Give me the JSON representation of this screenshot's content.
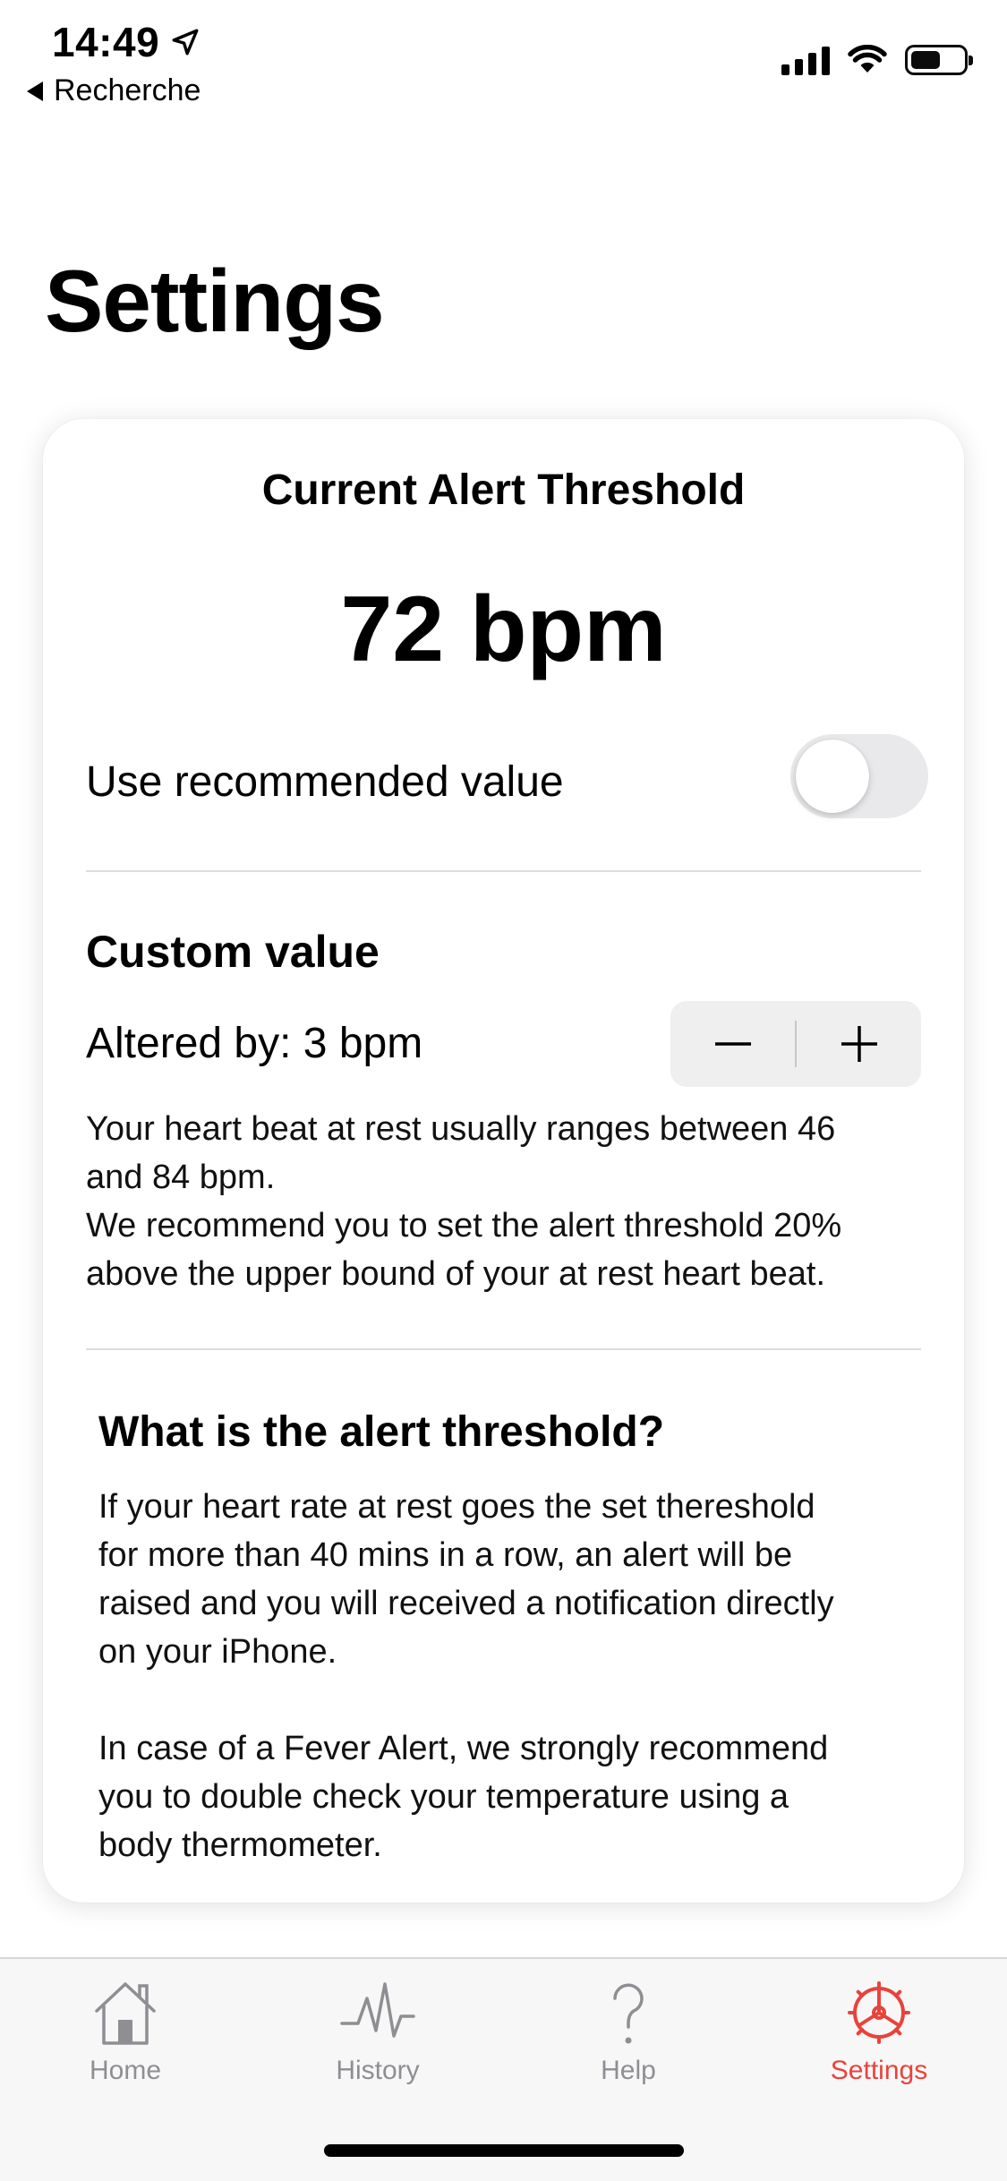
{
  "status_bar": {
    "time": "14:49",
    "back_label": "Recherche",
    "battery_level": 0.55
  },
  "page": {
    "title": "Settings"
  },
  "card": {
    "heading": "Current Alert Threshold",
    "threshold_value": "72 bpm",
    "use_recommended_label": "Use recommended value",
    "use_recommended_on": false,
    "custom_heading": "Custom value",
    "altered_label": "Altered by: 3 bpm",
    "stepper_minus": "−",
    "stepper_plus": "+",
    "range_text": "Your heart beat at rest usually ranges between 46\nand 84 bpm.\nWe recommend you to set the alert threshold 20%\nabove the upper bound of your at rest heart beat.",
    "info_heading": "What is the alert threshold?",
    "info_text_1": "If your heart rate at rest goes the set thereshold\nfor more than 40 mins in a row, an alert will be\nraised and you will received a notification directly\non your iPhone.",
    "info_text_2": "In case of a Fever Alert, we strongly recommend\nyou to double check your temperature using a\nbody thermometer."
  },
  "tab_bar": {
    "tabs": [
      {
        "label": "Home",
        "icon": "house-icon"
      },
      {
        "label": "History",
        "icon": "heartbeat-icon"
      },
      {
        "label": "Help",
        "icon": "question-mark-icon"
      },
      {
        "label": "Settings",
        "icon": "gear-icon"
      }
    ],
    "active": "Settings",
    "active_color": "#e8433b",
    "inactive_color": "#8e8e93"
  }
}
